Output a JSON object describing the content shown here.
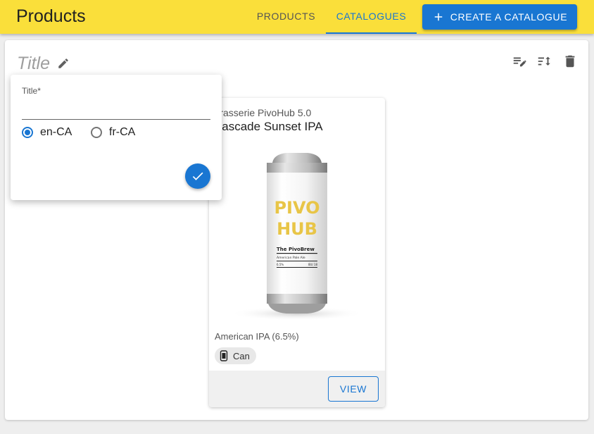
{
  "app": {
    "title": "Products"
  },
  "nav": {
    "tabs": [
      {
        "label": "Products",
        "active": false
      },
      {
        "label": "Catalogues",
        "active": true
      }
    ],
    "create_label": "Create a catalogue"
  },
  "catalogue": {
    "title_placeholder": "Title"
  },
  "popover": {
    "field_label": "Title*",
    "title_value": "",
    "locales": [
      {
        "label": "en-CA",
        "selected": true
      },
      {
        "label": "fr-CA",
        "selected": false
      }
    ]
  },
  "card": {
    "brewery": "Brasserie PivoHub 5.0",
    "name": "Cascade Sunset IPA",
    "style": "American IPA (6.5%)",
    "format": "Can",
    "view_label": "View",
    "can_label": {
      "logo_top": "PIVO",
      "logo_bottom": "HUB",
      "brew_name": "The PivoBrew",
      "brew_style": "American Pale Ale",
      "abv": "6.5%",
      "ibu": "IBU 18"
    }
  },
  "colors": {
    "appbar": "#fadf3a",
    "accent": "#1976d2",
    "logo_gold": "#e8c547"
  },
  "icons": [
    "pencil-icon",
    "plus-icon",
    "edit-list-icon",
    "sort-icon",
    "trash-icon",
    "can-icon",
    "check-icon"
  ]
}
